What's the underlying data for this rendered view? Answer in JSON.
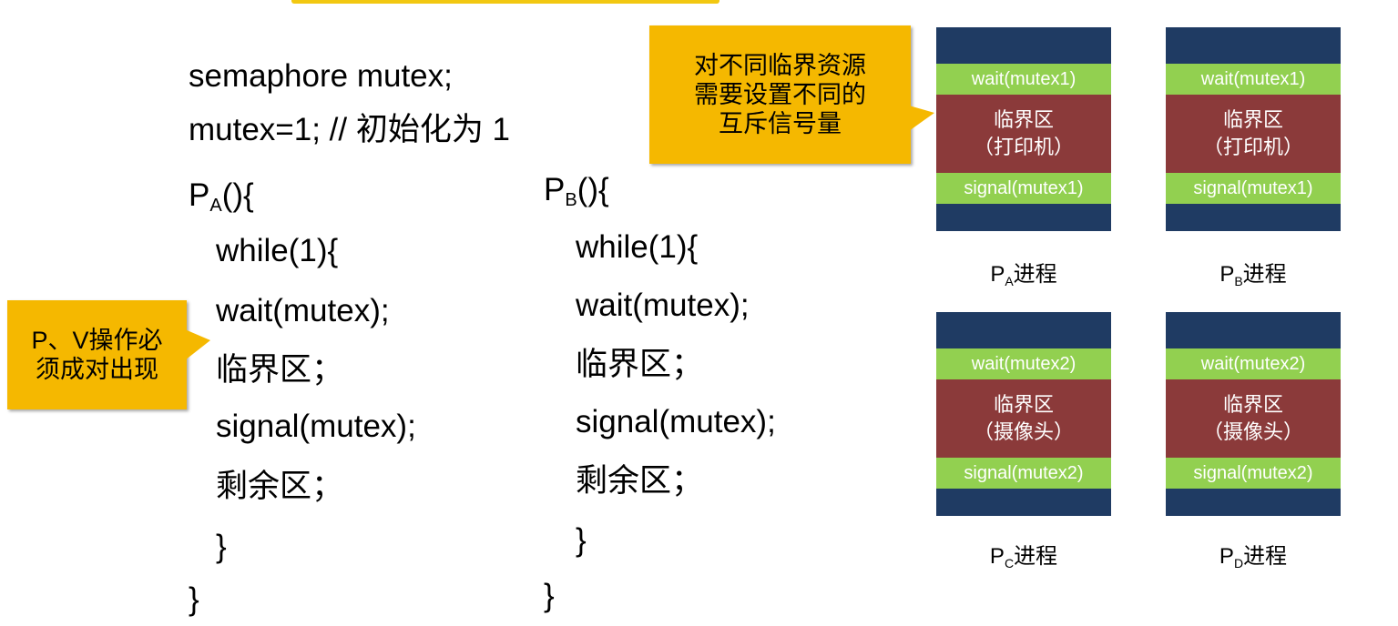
{
  "code": {
    "line1": "semaphore mutex;",
    "line2": "mutex=1; // 初始化为 1",
    "pa_header_p": "P",
    "pa_header_sub": "A",
    "pa_header_rest": "(){",
    "pb_header_p": "P",
    "pb_header_sub": "B",
    "pb_header_rest": "(){",
    "while_line": "while(1){",
    "wait_line": "wait(mutex);",
    "critical_line": "临界区；",
    "signal_line": "signal(mutex);",
    "remainder_line": "剩余区；",
    "inner_close": "}",
    "outer_close": "}"
  },
  "callouts": {
    "pv_pair": [
      "P、V操作必",
      "须成对出现"
    ],
    "different_mutex": [
      "对不同临界资源",
      "需要设置不同的",
      "互斥信号量"
    ]
  },
  "processes": [
    {
      "wait": "wait(mutex1)",
      "cs_title": "临界区",
      "cs_resource": "（打印机）",
      "signal": "signal(mutex1)",
      "label_p": "P",
      "label_sub": "A",
      "label_rest": "进程"
    },
    {
      "wait": "wait(mutex1)",
      "cs_title": "临界区",
      "cs_resource": "（打印机）",
      "signal": "signal(mutex1)",
      "label_p": "P",
      "label_sub": "B",
      "label_rest": "进程"
    },
    {
      "wait": "wait(mutex2)",
      "cs_title": "临界区",
      "cs_resource": "（摄像头）",
      "signal": "signal(mutex2)",
      "label_p": "P",
      "label_sub": "C",
      "label_rest": "进程"
    },
    {
      "wait": "wait(mutex2)",
      "cs_title": "临界区",
      "cs_resource": "（摄像头）",
      "signal": "signal(mutex2)",
      "label_p": "P",
      "label_sub": "D",
      "label_rest": "进程"
    }
  ],
  "colors": {
    "wait_signal_bar": "#92d050",
    "critical_section": "#8b3a3a",
    "process_bg": "#1f3b63",
    "callout": "#f5b800",
    "highlight_code": "#c00000"
  }
}
